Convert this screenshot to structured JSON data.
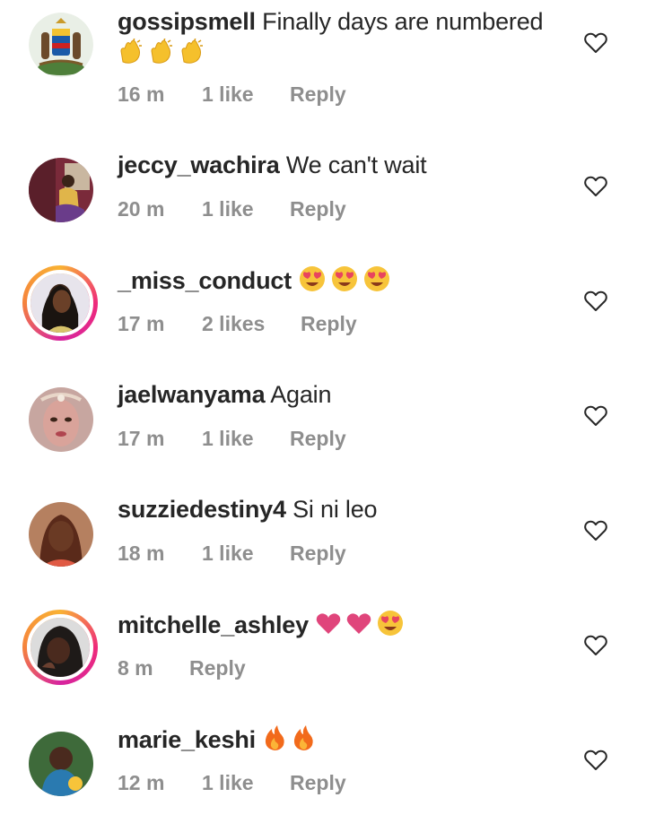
{
  "comments": [
    {
      "username": "gossipsmell",
      "text": "Finally days are numbered",
      "emoji": [
        "clap",
        "clap",
        "clap"
      ],
      "time": "16 m",
      "likes": "1 like",
      "reply": "Reply",
      "ring": false
    },
    {
      "username": "jeccy_wachira",
      "text": "We can't wait",
      "emoji": [],
      "time": "20 m",
      "likes": "1 like",
      "reply": "Reply",
      "ring": false
    },
    {
      "username": "_miss_conduct",
      "text": "",
      "emoji": [
        "heart-eyes",
        "heart-eyes",
        "heart-eyes"
      ],
      "time": "17 m",
      "likes": "2 likes",
      "reply": "Reply",
      "ring": true
    },
    {
      "username": "jaelwanyama",
      "text": "Again",
      "emoji": [],
      "time": "17 m",
      "likes": "1 like",
      "reply": "Reply",
      "ring": false
    },
    {
      "username": "suzziedestiny4",
      "text": "Si ni leo",
      "emoji": [],
      "time": "18 m",
      "likes": "1 like",
      "reply": "Reply",
      "ring": false
    },
    {
      "username": "mitchelle_ashley",
      "text": "",
      "emoji": [
        "pink-heart",
        "pink-heart",
        "heart-eyes"
      ],
      "time": "8 m",
      "likes": "",
      "reply": "Reply",
      "ring": true
    },
    {
      "username": "marie_keshi",
      "text": "",
      "emoji": [
        "fire",
        "fire"
      ],
      "time": "12 m",
      "likes": "1 like",
      "reply": "Reply",
      "ring": false
    }
  ],
  "colors": {
    "username": "#262626",
    "meta": "#8e8e8e",
    "heart_outline": "#262626",
    "ring": "#ee2a7b",
    "pink_heart": "#e0457b"
  }
}
